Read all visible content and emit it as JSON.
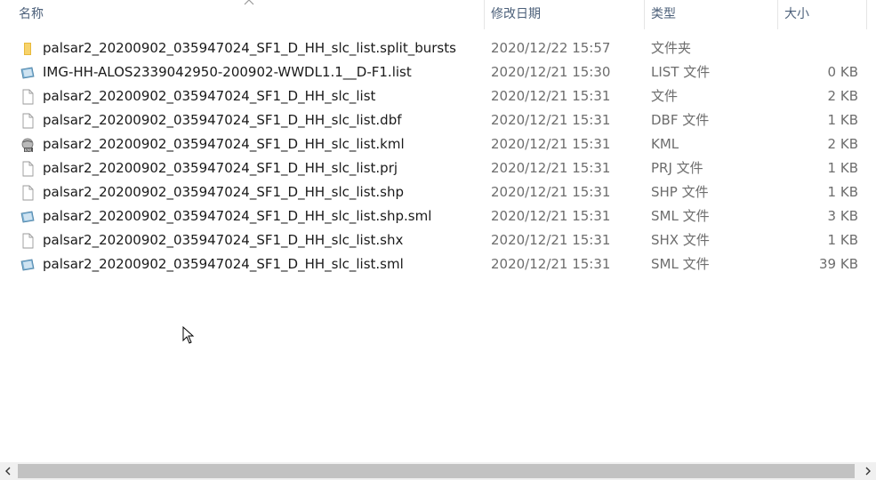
{
  "columns": {
    "name": "名称",
    "date": "修改日期",
    "type": "类型",
    "size": "大小"
  },
  "files": [
    {
      "name": "palsar2_20200902_035947024_SF1_D_HH_slc_list.split_bursts",
      "date": "2020/12/22 15:57",
      "type": "文件夹",
      "size": "",
      "icon": "folder-icon"
    },
    {
      "name": "IMG-HH-ALOS2339042950-200902-WWDL1.1__D-F1.list",
      "date": "2020/12/21 15:30",
      "type": "LIST 文件",
      "size": "0 KB",
      "icon": "list-file-icon"
    },
    {
      "name": "palsar2_20200902_035947024_SF1_D_HH_slc_list",
      "date": "2020/12/21 15:31",
      "type": "文件",
      "size": "2 KB",
      "icon": "file-icon"
    },
    {
      "name": "palsar2_20200902_035947024_SF1_D_HH_slc_list.dbf",
      "date": "2020/12/21 15:31",
      "type": "DBF 文件",
      "size": "1 KB",
      "icon": "file-icon"
    },
    {
      "name": "palsar2_20200902_035947024_SF1_D_HH_slc_list.kml",
      "date": "2020/12/21 15:31",
      "type": "KML",
      "size": "2 KB",
      "icon": "kml-icon"
    },
    {
      "name": "palsar2_20200902_035947024_SF1_D_HH_slc_list.prj",
      "date": "2020/12/21 15:31",
      "type": "PRJ 文件",
      "size": "1 KB",
      "icon": "file-icon"
    },
    {
      "name": "palsar2_20200902_035947024_SF1_D_HH_slc_list.shp",
      "date": "2020/12/21 15:31",
      "type": "SHP 文件",
      "size": "1 KB",
      "icon": "file-icon"
    },
    {
      "name": "palsar2_20200902_035947024_SF1_D_HH_slc_list.shp.sml",
      "date": "2020/12/21 15:31",
      "type": "SML 文件",
      "size": "3 KB",
      "icon": "list-file-icon"
    },
    {
      "name": "palsar2_20200902_035947024_SF1_D_HH_slc_list.shx",
      "date": "2020/12/21 15:31",
      "type": "SHX 文件",
      "size": "1 KB",
      "icon": "file-icon"
    },
    {
      "name": "palsar2_20200902_035947024_SF1_D_HH_slc_list.sml",
      "date": "2020/12/21 15:31",
      "type": "SML 文件",
      "size": "39 KB",
      "icon": "list-file-icon"
    }
  ],
  "colors": {
    "header_text": "#4c607a",
    "meta_text": "#6d6d6d",
    "folder": "#f2c94c",
    "scroll_thumb": "#c2c2c2"
  }
}
